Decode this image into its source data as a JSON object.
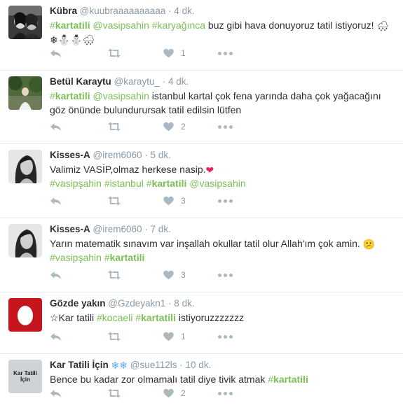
{
  "tweets": [
    {
      "fullname": "Kübra",
      "username": "@kuubraaaaaaaaaa",
      "time": "· 4 dk.",
      "likes": "1",
      "parts": [
        {
          "tag": "#",
          "b": "kartatili"
        },
        {
          "s": " "
        },
        {
          "tag": "@vasipsahin"
        },
        {
          "s": " "
        },
        {
          "tag": "#karyağınca"
        },
        {
          "s": " buz gibi hava donuyoruz tatil istiyoruz! "
        },
        {
          "e": "🌨"
        },
        {
          "s": " "
        },
        {
          "e": "❄"
        },
        {
          "e": "⛄"
        },
        {
          "e": "⛄"
        },
        {
          "e": "🌨"
        }
      ]
    },
    {
      "fullname": "Betül Karaytu",
      "username": "@karaytu_",
      "time": "· 4 dk.",
      "likes": "2",
      "parts": [
        {
          "tag": "#",
          "b": "kartatili"
        },
        {
          "s": " "
        },
        {
          "tag": "@vasipsahin"
        },
        {
          "s": "  istanbul kartal çok fena yarında daha çok yağacağını göz önünde bulundurursak tatil edilsin lütfen"
        }
      ]
    },
    {
      "fullname": "Kisses-A",
      "username": "@irem6060",
      "time": "· 5 dk.",
      "likes": "3",
      "parts": [
        {
          "s": "Valimiz VASİP,olmaz herkese nasip."
        },
        {
          "e": "❤",
          "color": "#e0245e"
        },
        {
          "br": true
        },
        {
          "tag": "#vasipşahin"
        },
        {
          "s": " "
        },
        {
          "tag": "#istanbul"
        },
        {
          "s": " "
        },
        {
          "tag": "#",
          "b": "kartatili"
        },
        {
          "s": " "
        },
        {
          "tag": "@vasipsahin"
        }
      ]
    },
    {
      "fullname": "Kisses-A",
      "username": "@irem6060",
      "time": "· 7 dk.",
      "likes": "3",
      "parts": [
        {
          "s": "Yarın matematik sınavım var inşallah okullar tatil olur Allah'ım çok amin. "
        },
        {
          "e": "😕"
        },
        {
          "br": true
        },
        {
          "tag": "#vasipşahin"
        },
        {
          "s": " "
        },
        {
          "tag": "#",
          "b": "kartatili"
        }
      ]
    },
    {
      "fullname": "Gözde yakın",
      "username": "@Gzdeyakn1",
      "time": "· 8 dk.",
      "likes": "1",
      "parts": [
        {
          "s": "☆Kar tatili "
        },
        {
          "tag": "#kocaeli"
        },
        {
          "s": " "
        },
        {
          "tag": "#",
          "b": "kartatili"
        },
        {
          "s": " istiyoruzzzzzzz"
        }
      ]
    },
    {
      "fullname": "Kar Tatili İçin",
      "name_emoji": "❄❄",
      "username": "@sue112ls",
      "time": "· 10 dk.",
      "likes": "2",
      "avatar_text": "Kar Tatili İçin",
      "parts": [
        {
          "s": "Bence bu kadar zor olmamalı tatil diye tivik atmak "
        },
        {
          "tag": "#",
          "b": "kartatili"
        }
      ]
    }
  ]
}
